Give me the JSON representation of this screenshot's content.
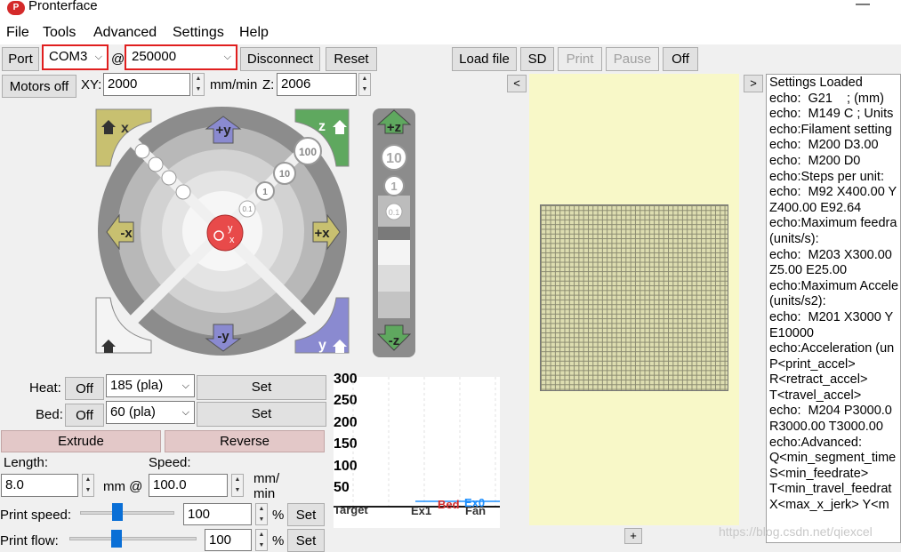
{
  "window": {
    "title": "Pronterface",
    "icon_text": "P",
    "minimize_glyph": "—"
  },
  "menu": [
    "File",
    "Tools",
    "Advanced",
    "Settings",
    "Help"
  ],
  "toolbar": {
    "port_label": "Port",
    "port_value": "COM3",
    "at": "@",
    "baud_value": "250000",
    "disconnect_label": "Disconnect",
    "reset_label": "Reset",
    "load_file_label": "Load file",
    "sd_label": "SD",
    "print_label": "Print",
    "pause_label": "Pause",
    "off_label": "Off"
  },
  "motion": {
    "motors_off_label": "Motors off",
    "xy_label": "XY:",
    "xy_value": "2000",
    "mm_min_label": "mm/min",
    "z_label": "Z:",
    "z_value": "2006"
  },
  "jog": {
    "home_x": "x",
    "home_z": "z",
    "home_y": "y",
    "plus_y": "+y",
    "minus_y": "-y",
    "plus_x": "+x",
    "minus_x": "-x",
    "center_y": "y",
    "center_x": "x",
    "step_100": "100",
    "step_10": "10",
    "step_1": "1",
    "step_01": "0.1",
    "z_plus": "+z",
    "z_minus": "-z",
    "z_10": "10",
    "z_1": "1",
    "z_01": "0.1"
  },
  "temps": {
    "heat_label": "Heat:",
    "heat_off": "Off",
    "heat_value": "185 (pla)",
    "heat_set": "Set",
    "bed_label": "Bed:",
    "bed_off": "Off",
    "bed_value": "60 (pla)",
    "bed_set": "Set"
  },
  "extrude": {
    "extrude_label": "Extrude",
    "reverse_label": "Reverse",
    "length_label": "Length:",
    "speed_label": "Speed:",
    "length_value": "8.0",
    "mm_at": "mm @",
    "speed_value": "100.0",
    "unit_line1": "mm/",
    "unit_line2": "min"
  },
  "print_speed": {
    "label": "Print speed:",
    "value": "100",
    "pct": "%",
    "set": "Set",
    "level": 0.36
  },
  "print_flow": {
    "label": "Print flow:",
    "value": "100",
    "pct": "%",
    "set": "Set",
    "level": 0.34
  },
  "graph": {
    "ticks": [
      "300",
      "250",
      "200",
      "150",
      "100",
      "50"
    ],
    "legend_target": "Target",
    "legend_ex1": "Ex1",
    "legend_bed": "Bed",
    "legend_ex0": "Ex0",
    "legend_fan": "Fan"
  },
  "preview": {
    "left_nav": "<",
    "right_nav": ">",
    "plus": "+"
  },
  "console_lines": [
    "Settings Loaded",
    "echo:  G21    ; (mm)",
    "echo:  M149 C ; Units",
    "echo:Filament setting",
    "echo:  M200 D3.00",
    "echo:  M200 D0",
    "echo:Steps per unit:",
    "echo:  M92 X400.00 Y",
    "Z400.00 E92.64",
    "echo:Maximum feedra",
    "(units/s):",
    "echo:  M203 X300.00",
    "Z5.00 E25.00",
    "echo:Maximum Accele",
    "(units/s2):",
    "echo:  M201 X3000 Y",
    "E10000",
    "echo:Acceleration (un",
    "P<print_accel>",
    "R<retract_accel>",
    "T<travel_accel>",
    "echo:  M204 P3000.0",
    "R3000.00 T3000.00",
    "echo:Advanced:",
    "Q<min_segment_time",
    "S<min_feedrate>",
    "T<min_travel_feedrat",
    "X<max_x_jerk> Y<m"
  ],
  "watermark": "https://blog.csdn.net/qiexcel",
  "colors": {
    "combo_border": "#e01f1f",
    "preview_bg": "#f8f8c8",
    "jog_center": "#e84a4a"
  }
}
